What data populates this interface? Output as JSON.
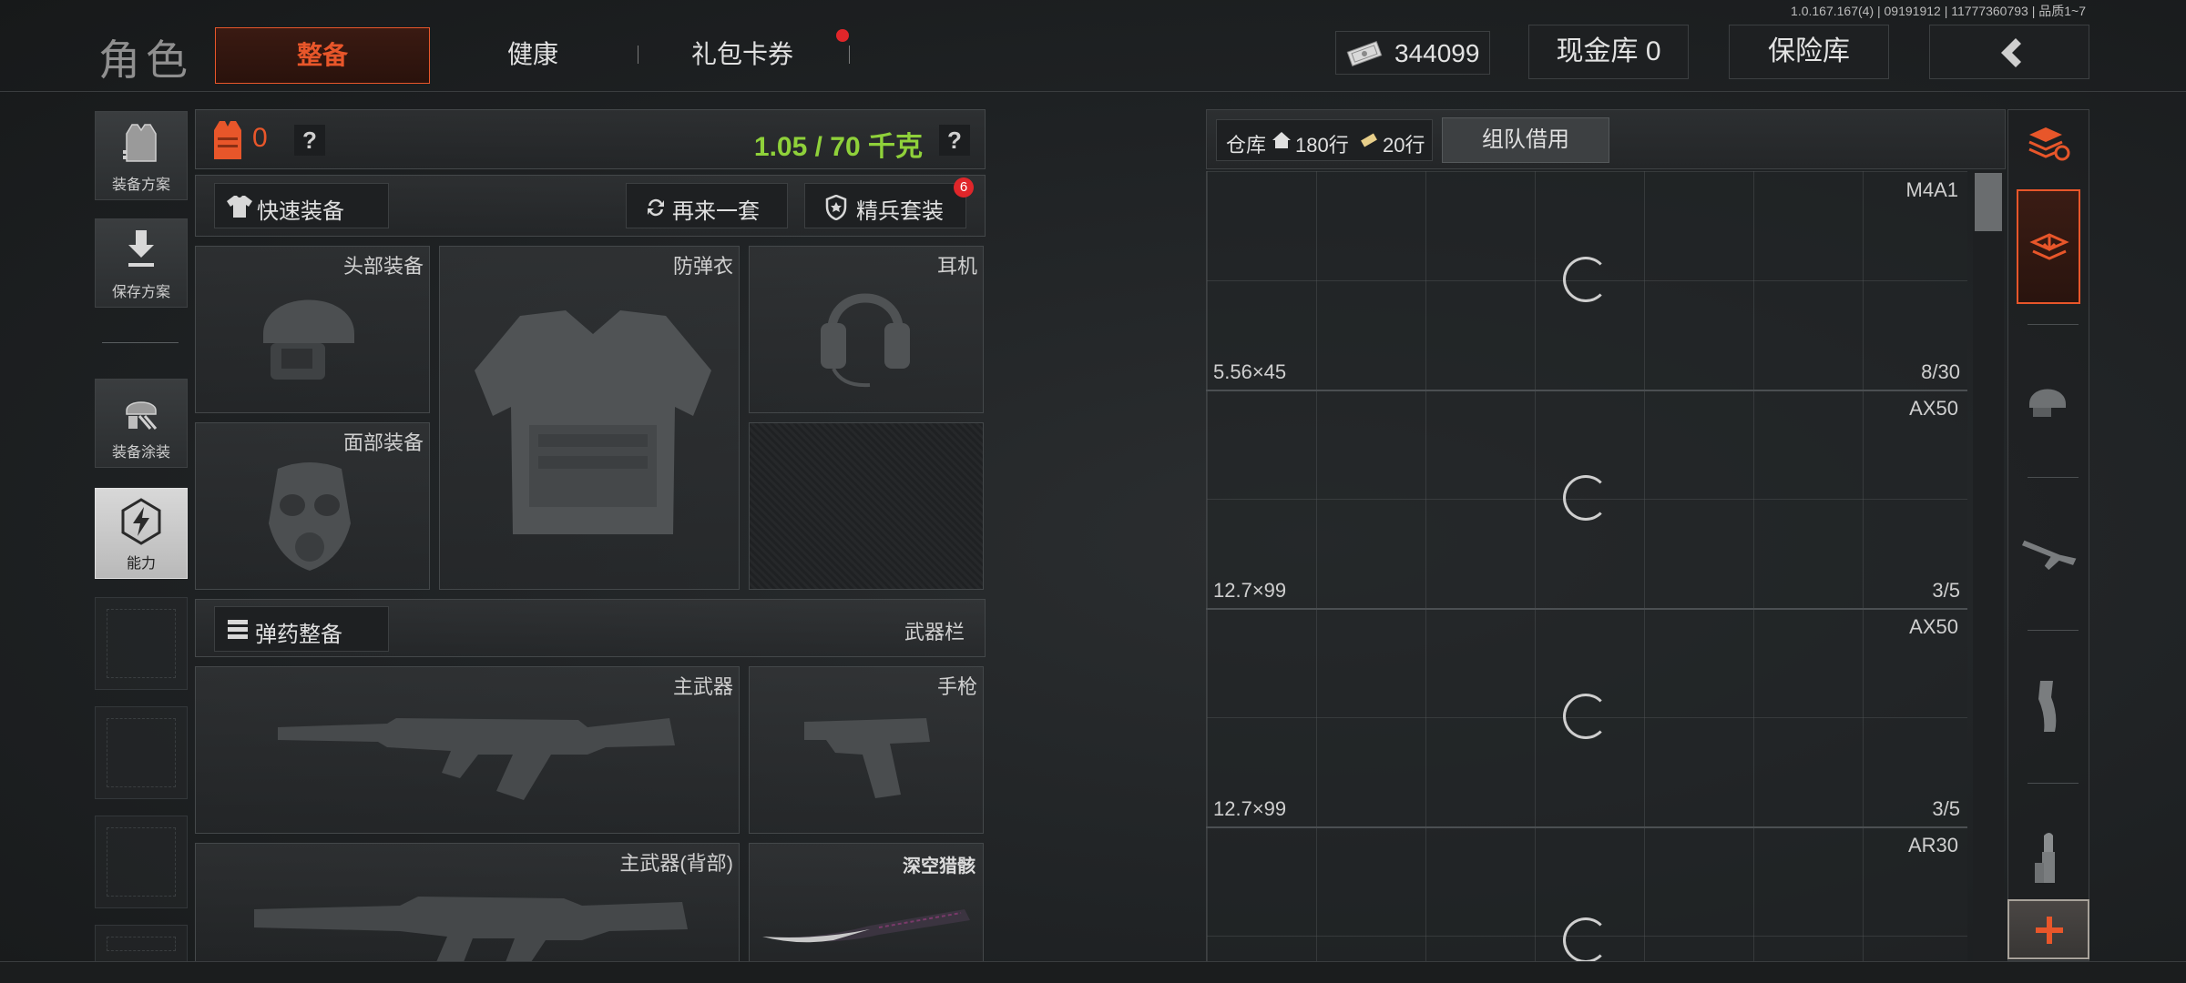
{
  "version_text": "1.0.167.167(4) | 09191912 | 11777360793 | 品质1~7",
  "header": {
    "title": "角色",
    "tabs": [
      {
        "label": "整备",
        "active": true
      },
      {
        "label": "健康",
        "active": false
      },
      {
        "label": "礼包卡券",
        "active": false
      }
    ],
    "currency_value": "344099",
    "cash_vault": "现金库 0",
    "safe_vault": "保险库"
  },
  "sidebar": {
    "items": [
      {
        "label": "装备方案",
        "icon": "armor-vest-icon"
      },
      {
        "label": "保存方案",
        "icon": "download-icon"
      },
      {
        "label": "装备涂装",
        "icon": "paint-icon"
      },
      {
        "label": "能力",
        "icon": "ability-icon"
      }
    ]
  },
  "loadout": {
    "armor_count": "0",
    "help_mark": "?",
    "weight": "1.05 / 70 千克",
    "quick_equip": "快速装备",
    "reroll": "再来一套",
    "elite_set": "精兵套装",
    "elite_badge": "6",
    "slots": {
      "head": "头部装备",
      "vest": "防弹衣",
      "earphones": "耳机",
      "face": "面部装备"
    },
    "ammo_equip": "弹药整备",
    "weapon_bar": "武器栏",
    "weapon_slots": {
      "primary": "主武器",
      "pistol": "手枪",
      "primary_back": "主武器(背部)",
      "melee": "深空猎骸"
    }
  },
  "warehouse": {
    "label": "仓库",
    "rows_home": "180行",
    "rows_ticket": "20行",
    "team_borrow": "组队借用",
    "weapons": [
      {
        "name": "M4A1",
        "caliber": "5.56×45",
        "count": "8/30"
      },
      {
        "name": "AX50",
        "caliber": "12.7×99",
        "count": "3/5"
      },
      {
        "name": "AX50",
        "caliber": "12.7×99",
        "count": "3/5"
      },
      {
        "name": "AR30",
        "caliber": "",
        "count": ""
      }
    ]
  },
  "right_strip": {
    "icons": [
      "stack-refresh-icon",
      "stack-download-icon",
      "helmet-icon",
      "rifle-icon",
      "magazine-icon",
      "bullet-icon",
      "plus-icon"
    ]
  },
  "colors": {
    "accent_orange": "#e8562a",
    "weight_green": "#8fd13a",
    "badge_red": "#e0262a"
  }
}
